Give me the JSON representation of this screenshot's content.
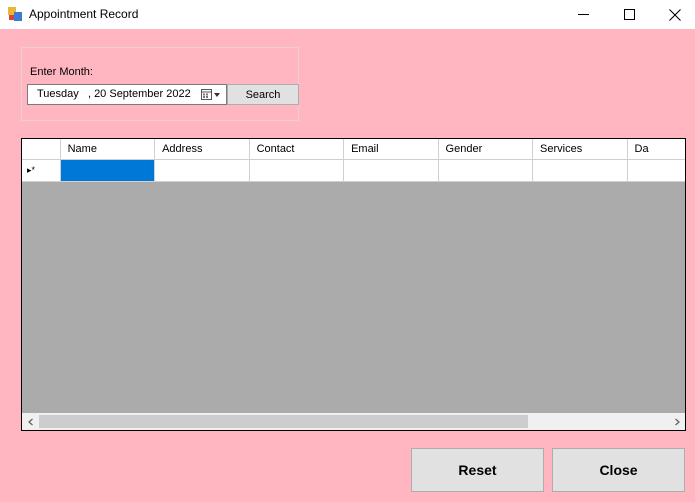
{
  "window": {
    "title": "Appointment Record",
    "controls": [
      "minimize-icon",
      "maximize-icon",
      "close-icon"
    ]
  },
  "search": {
    "label": "Enter Month:",
    "date_value": "Tuesday   , 20 September 2022",
    "button_label": "Search"
  },
  "grid": {
    "columns": [
      "Name",
      "Address",
      "Contact",
      "Email",
      "Gender",
      "Services",
      "Da"
    ],
    "new_row_marker": "▸*",
    "rows": []
  },
  "actions": {
    "reset_label": "Reset",
    "close_label": "Close"
  },
  "colors": {
    "background": "#ffb6c1",
    "grid_empty": "#ababab",
    "selection": "#0078d7"
  }
}
